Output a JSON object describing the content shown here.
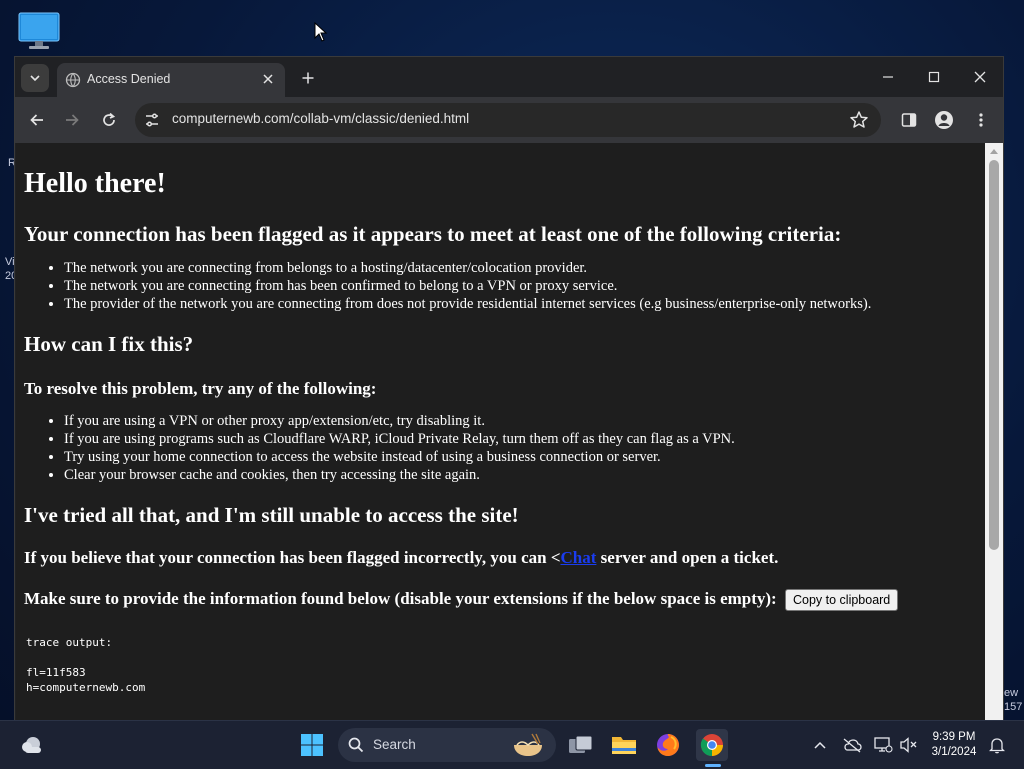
{
  "desktop": {
    "fragment_left": [
      "R",
      "Vi",
      "20"
    ],
    "fragment_right": [
      "ew",
      "157"
    ]
  },
  "browser": {
    "tab": {
      "title": "Access Denied"
    },
    "address": {
      "url": "computernewb.com/collab-vm/classic/denied.html"
    }
  },
  "page": {
    "h1": "Hello there!",
    "criteria_heading": "Your connection has been flagged as it appears to meet at least one of the following criteria:",
    "criteria": [
      "The network you are connecting from belongs to a hosting/datacenter/colocation provider.",
      "The network you are connecting from has been confirmed to belong to a VPN or proxy service.",
      "The provider of the network you are connecting from does not provide residential internet services (e.g business/enterprise-only networks)."
    ],
    "fix_heading": "How can I fix this?",
    "resolve_heading": "To resolve this problem, try any of the following:",
    "fixes": [
      "If you are using a VPN or other proxy app/extension/etc, try disabling it.",
      "If you are using programs such as Cloudflare WARP, iCloud Private Relay, turn them off as they can flag as a VPN.",
      "Try using your home connection to access the website instead of using a business connection or server.",
      "Clear your browser cache and cookies, then try accessing the site again."
    ],
    "tried_heading": "I've tried all that, and I'm still unable to access the site!",
    "ticket_before": "If you believe that your connection has been flagged incorrectly, you can <",
    "ticket_link": "Chat",
    "ticket_after": " server and open a ticket.",
    "provide_text": "Make sure to provide the information found below (disable your extensions if the below space is empty):",
    "copy_button": "Copy to clipboard",
    "trace": "trace output:\n\nfl=11f583\nh=computernewb.com\n"
  },
  "taskbar": {
    "search_placeholder": "Search",
    "time": "9:39 PM",
    "date": "3/1/2024"
  },
  "colors": {
    "page_background": "#1e1e1e",
    "link": "#1a3cf0",
    "browser_frame": "#202124",
    "toolbar": "#35363a"
  }
}
